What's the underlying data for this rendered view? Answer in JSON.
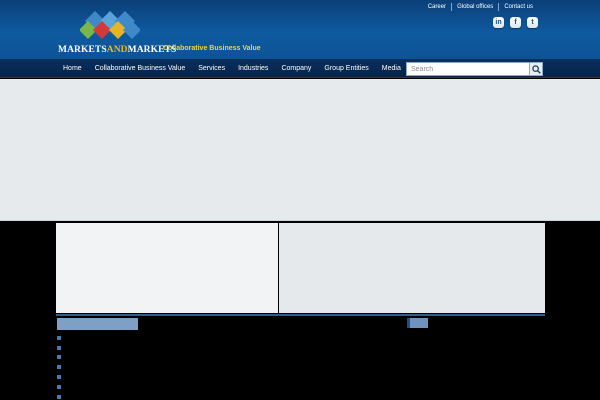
{
  "header": {
    "brand_name_part1": "MARKETS",
    "brand_name_and": "AND",
    "brand_name_part2": "MARKETS",
    "tagline": "Collaborative Business Value",
    "top_links": [
      "Career",
      "Global offices",
      "Contact us"
    ],
    "social": [
      {
        "icon": "linkedin-icon",
        "glyph": "in"
      },
      {
        "icon": "facebook-icon",
        "glyph": "f"
      },
      {
        "icon": "twitter-icon",
        "glyph": "t"
      }
    ]
  },
  "nav": {
    "items": [
      "Home",
      "Collaborative Business Value",
      "Services",
      "Industries",
      "Company",
      "Group Entities",
      "Media"
    ],
    "search_placeholder": "Search"
  },
  "content": {
    "section_title": "",
    "side_title": "",
    "news_count_visible": 7
  },
  "colors": {
    "header_blue": "#0f5aa0",
    "nav_navy": "#06244a",
    "accent_gold": "#f3b21a",
    "tagline_yellow": "#f4d23c",
    "banner_gray": "#e7eaec"
  }
}
